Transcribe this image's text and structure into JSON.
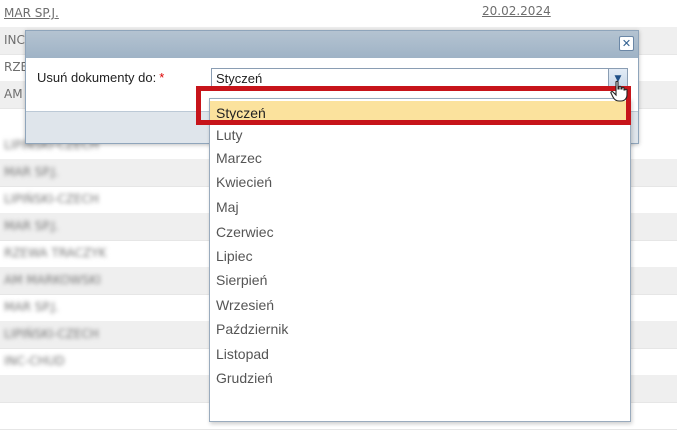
{
  "background_rows": [
    {
      "name": "MAR SP.J.",
      "date": "20.02.2024",
      "blur": false
    },
    {
      "name": "INC",
      "date": "",
      "blur": false
    },
    {
      "name": "RZE",
      "date": "",
      "blur": false
    },
    {
      "name": "AM",
      "date": "",
      "blur": false
    },
    {
      "name": "LIPIŃSKI-CZECH",
      "date": "",
      "blur": true
    },
    {
      "name": "MAR SP.J.",
      "date": "",
      "blur": true
    },
    {
      "name": "LIPIŃSKI-CZECH",
      "date": "",
      "blur": true
    },
    {
      "name": "MAR SP.J.",
      "date": "",
      "blur": true
    },
    {
      "name": "RZEWA TRACZYK",
      "date": "",
      "blur": true
    },
    {
      "name": "AM MARKOWSKI",
      "date": "",
      "blur": true
    },
    {
      "name": "MAR SP.J.",
      "date": "",
      "blur": true
    },
    {
      "name": "LIPIŃSKI-CZECH",
      "date": "",
      "blur": true
    },
    {
      "name": "INC-CHUD",
      "date": "",
      "blur": true
    }
  ],
  "modal": {
    "close_symbol": "✕",
    "field_label": "Usuń dokumenty do:",
    "required_mark": "*",
    "selected_value": "Styczeń",
    "arrow_symbol": "▼"
  },
  "dropdown": {
    "options": [
      "Styczeń",
      "Luty",
      "Marzec",
      "Kwiecień",
      "Maj",
      "Czerwiec",
      "Lipiec",
      "Sierpień",
      "Wrzesień",
      "Październik",
      "Listopad",
      "Grudzień"
    ],
    "selected_index": 0
  },
  "colors": {
    "highlight": "#c7141a",
    "selected_option_bg": "#fbe29d",
    "modal_header": "#a8b9cb"
  },
  "icons": {
    "close": "close-icon",
    "select_arrow": "chevron-down-icon",
    "cursor": "hand-pointer-icon"
  }
}
